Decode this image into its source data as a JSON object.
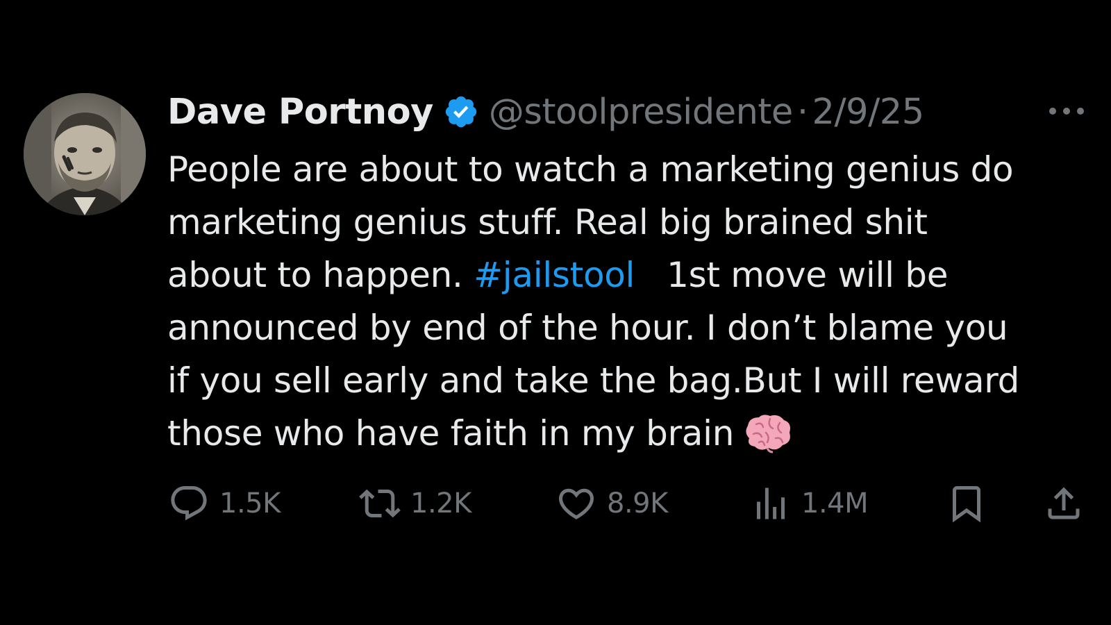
{
  "tweet": {
    "author": {
      "display_name": "Dave Portnoy",
      "handle": "@stoolpresidente",
      "verified": true,
      "avatar_icon": "profile-photo-avatar"
    },
    "separator": "·",
    "date": "2/9/25",
    "text_lines": [
      {
        "text": "People are about to watch a marketing genius do"
      },
      {
        "text": "marketing genius stuff. Real big brained shit"
      },
      {
        "before": "about to happen. ",
        "hashtag": "#jailstool",
        "after": "1st move will be"
      },
      {
        "text": "announced by end of the hour. I don’t blame you"
      },
      {
        "text": "if you sell early and take the bag.But I will reward"
      },
      {
        "text": "those who have faith in my brain",
        "emoji_icon": "brain-emoji"
      }
    ],
    "metrics": {
      "replies": "1.5K",
      "reposts": "1.2K",
      "likes": "8.9K",
      "views": "1.4M"
    }
  },
  "colors": {
    "background": "#000000",
    "primary_text": "#e7e9ea",
    "secondary_text": "#71767b",
    "accent_blue": "#1d9bf0",
    "verified_badge": "#1d9bf0"
  }
}
